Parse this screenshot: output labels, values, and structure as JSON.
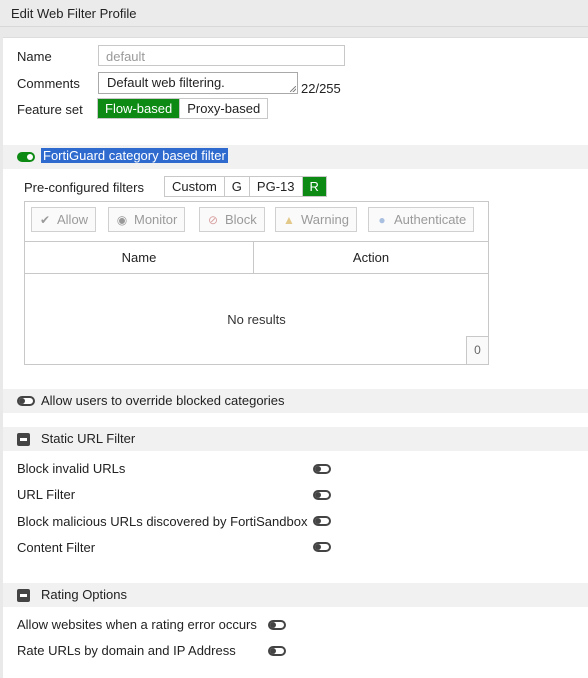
{
  "window": {
    "title": "Edit Web Filter Profile"
  },
  "form": {
    "name_label": "Name",
    "name_value": "default",
    "comments_label": "Comments",
    "comments_value": "Default web filtering.",
    "comments_counter": "22/255",
    "feature_set_label": "Feature set",
    "feature_set_options": [
      "Flow-based",
      "Proxy-based"
    ],
    "feature_set_selected": "Flow-based"
  },
  "fortiguard": {
    "title": "FortiGuard category based filter",
    "enabled": true,
    "preconfigured_label": "Pre-configured filters",
    "preconfigured_options": [
      "Custom",
      "G",
      "PG-13",
      "R"
    ],
    "preconfigured_selected": "R",
    "toolbar": [
      "Allow",
      "Monitor",
      "Block",
      "Warning",
      "Authenticate"
    ],
    "columns": [
      "Name",
      "Action"
    ],
    "empty_text": "No results",
    "count": "0"
  },
  "override": {
    "label": "Allow users to override blocked categories",
    "enabled": false
  },
  "static_url": {
    "title": "Static URL Filter",
    "items": [
      {
        "label": "Block invalid URLs",
        "enabled": false
      },
      {
        "label": "URL Filter",
        "enabled": false
      },
      {
        "label": "Block malicious URLs discovered by FortiSandbox",
        "enabled": false
      },
      {
        "label": "Content Filter",
        "enabled": false
      }
    ]
  },
  "rating": {
    "title": "Rating Options",
    "items": [
      {
        "label": "Allow websites when a rating error occurs",
        "enabled": false
      },
      {
        "label": "Rate URLs by domain and IP Address",
        "enabled": false
      }
    ]
  },
  "colors": {
    "accent_green": "#0d8a14",
    "selection_blue": "#2f6bcf",
    "disabled_text": "#9a9a9a"
  }
}
